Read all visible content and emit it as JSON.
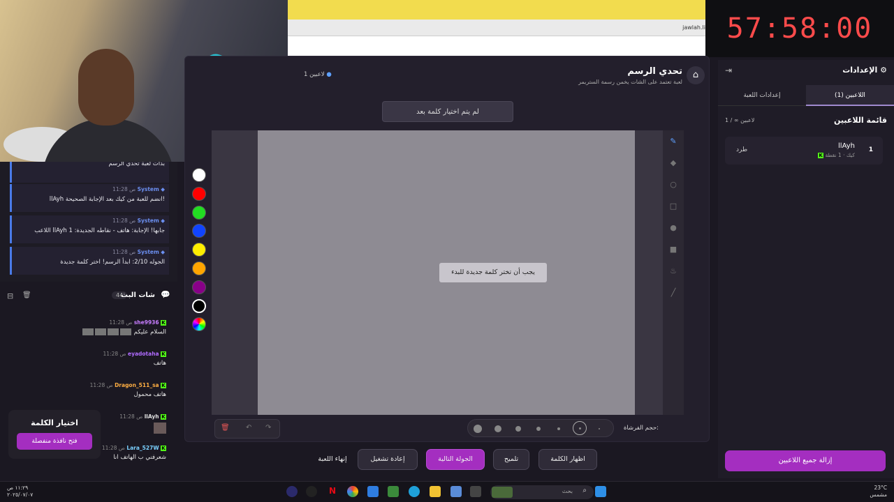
{
  "timer": "57:58:00",
  "browser": {
    "url": "jawlah.li"
  },
  "game": {
    "title": "تحدي الرسم",
    "subtitle": "لعبة تعتمد على الشات يخمن رسمة الستريمر",
    "players_count": "1 لاعبين",
    "no_word_selected": "لم يتم اختيار كلمة بعد",
    "must_pick_word": "يجب أن تختر كلمة جديدة للبدء",
    "brush_size_label": "حجم الفرشاة:"
  },
  "palette": [
    "#ffffff",
    "#ff0000",
    "#22dd22",
    "#1144ff",
    "#ffee00",
    "#ffa500",
    "#880088",
    "#000000",
    "rainbow"
  ],
  "actions": {
    "end_game": "إنهاء اللعبة",
    "restart": "إعادة تشغيل",
    "next_round": "الجولة التالية",
    "hint": "تلميح",
    "reveal_word": "اظهار الكلمة"
  },
  "system_messages": [
    {
      "sender": "",
      "time": "",
      "text": "بدأت لعبة تحدي الرسم"
    },
    {
      "sender": "System",
      "time": "11:28 ص",
      "text": "llAyh انضم للعبة من كيك بعد الإجابة الصحيحة!"
    },
    {
      "sender": "System",
      "time": "11:28 ص",
      "text": "اللاعب llAyh جابها! الإجابة: هاتف - نقاطه الجديدة: 1"
    },
    {
      "sender": "System",
      "time": "11:28 ص",
      "text": "الجوله 2/10: ابدأ الرسم! اختر كلمة جديدة"
    }
  ],
  "stream_chat": {
    "title": "شات البث",
    "count": "44",
    "messages": [
      {
        "user": "she9936",
        "user_color": "#c77dff",
        "time": "11:28 ص",
        "text": "السلام عليكم"
      },
      {
        "user": "eyadotaha",
        "user_color": "#b06bff",
        "time": "11:28 ص",
        "text": "هاتف"
      },
      {
        "user": "Dragon_511_sa",
        "user_color": "#ffae42",
        "time": "11:28 ص",
        "text": "هاتف محمول"
      },
      {
        "user": "llAyh",
        "user_color": "#e0e0e0",
        "time": "11:28 ص",
        "text": ""
      },
      {
        "user": "Lara_527W",
        "user_color": "#7ad0ff",
        "time": "11:28 ص",
        "text": "شعرفني ب الهاتف انا"
      }
    ]
  },
  "pick_word": {
    "title": "اختيار الكلمة",
    "button": "فتح نافذة منفصلة"
  },
  "settings": {
    "title": "الإعدادات",
    "tab_players": "اللاعبين (1)",
    "tab_game_settings": "إعدادات اللعبة",
    "players_list_title": "قائمة اللاعبين",
    "players_list_count": "1 / ∞ لاعبين",
    "players": [
      {
        "rank": "1",
        "name": "llAyh",
        "platform": "كيك",
        "points": "1 نقطة",
        "kick_label": "طرد"
      }
    ],
    "remove_all": "إزالة جميع اللاعبين"
  },
  "taskbar": {
    "search_placeholder": "بحث",
    "weather_temp": "23°C",
    "weather_desc": "مشمس",
    "time": "١١:٢٩ ص",
    "date": "٢٠٢٥/٠٧/٠٧"
  }
}
